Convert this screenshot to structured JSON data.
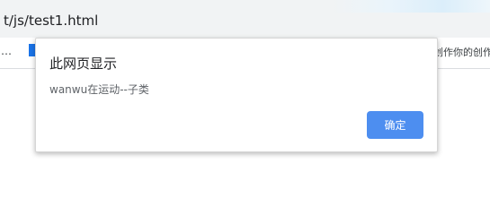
{
  "browser": {
    "address_text": "t/js/test1.html",
    "bookmark_left_text": "…",
    "bookmark_right_text": "创作你的创作"
  },
  "dialog": {
    "title": "此网页显示",
    "message": "wanwu在运动--子类",
    "ok_label": "确定"
  },
  "colors": {
    "button_bg": "#4d8ef0",
    "button_text": "#ffffff",
    "title_text": "#202124",
    "message_text": "#5f6368"
  }
}
